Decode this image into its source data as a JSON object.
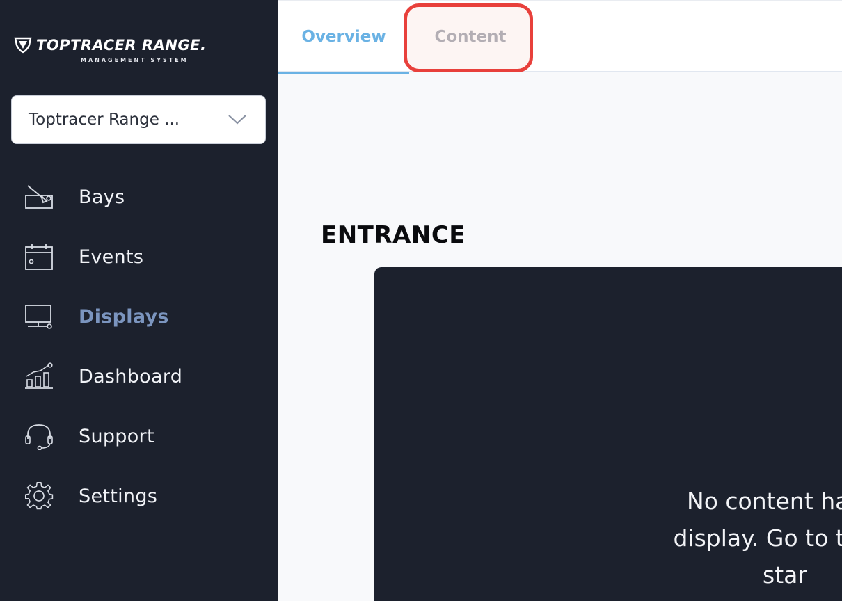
{
  "sidebar": {
    "logo_text": "TOPTRACER RANGE.",
    "logo_subtitle": "MANAGEMENT SYSTEM",
    "range_selector": {
      "value": "Toptracer Range ...",
      "icon": "chevron-down-icon"
    },
    "items": [
      {
        "label": "Bays",
        "icon": "golf-bay-icon",
        "active": false
      },
      {
        "label": "Events",
        "icon": "calendar-icon",
        "active": false
      },
      {
        "label": "Displays",
        "icon": "monitor-icon",
        "active": true
      },
      {
        "label": "Dashboard",
        "icon": "chart-icon",
        "active": false
      },
      {
        "label": "Support",
        "icon": "headset-icon",
        "active": false
      },
      {
        "label": "Settings",
        "icon": "gear-icon",
        "active": false
      }
    ]
  },
  "tabs": [
    {
      "label": "Overview",
      "active": true
    },
    {
      "label": "Content",
      "active": false
    }
  ],
  "main": {
    "section_title": "ENTRANCE",
    "message_lines": [
      "No content has b",
      "display. Go to the C",
      "star"
    ]
  },
  "colors": {
    "sidebar_bg": "#1c212d",
    "active_nav": "#7b95bf",
    "active_tab": "#6ab2e4",
    "highlight": "#e8403b"
  }
}
